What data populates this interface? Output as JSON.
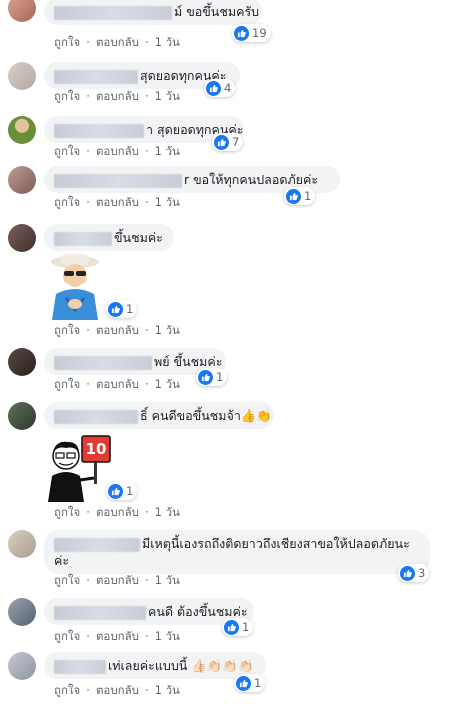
{
  "actions": {
    "like": "ถูกใจ",
    "reply": "ตอบกลับ",
    "time": "1 วัน",
    "sep": "·"
  },
  "comments": [
    {
      "text": "ม์ ขอขึ้นชมครับ",
      "reactions": "19"
    },
    {
      "text": "สุดยอดทุกคนค่ะ",
      "reactions": "4"
    },
    {
      "text": "า สุดยอดทุกคนค่ะ",
      "reactions": "7"
    },
    {
      "text": "r ขอให้ทุกคนปลอดภัยค่ะ",
      "reactions": "1"
    },
    {
      "text": "ขึ้นชมค่ะ",
      "reactions": "1",
      "sticker": "old-man-clapping-sticker"
    },
    {
      "text": "พย์ ขึ้นชมค่ะ",
      "reactions": "1"
    },
    {
      "text": "ธิ์ คนดีขอขึ้นชมจ้า👍👏",
      "reactions": "1",
      "sticker": "score-10-sticker",
      "sticker_text": "10"
    },
    {
      "text": "มีเหตุนี้เองรถถึงติดยาวถึงเชียงสาขอให้ปลอดภัยนะค่ะ",
      "reactions": "3"
    },
    {
      "text": "คนดี ต้องขึ้นชมค่ะ",
      "reactions": "1"
    },
    {
      "text": "เท่เลยค่ะแบบนี้ 👍🏻👏🏻👏🏻👏🏻",
      "reactions": "1"
    }
  ],
  "colors": {
    "like_blue": "#1877f2",
    "bubble_bg": "#f2f3f5",
    "meta_text": "#606770"
  }
}
